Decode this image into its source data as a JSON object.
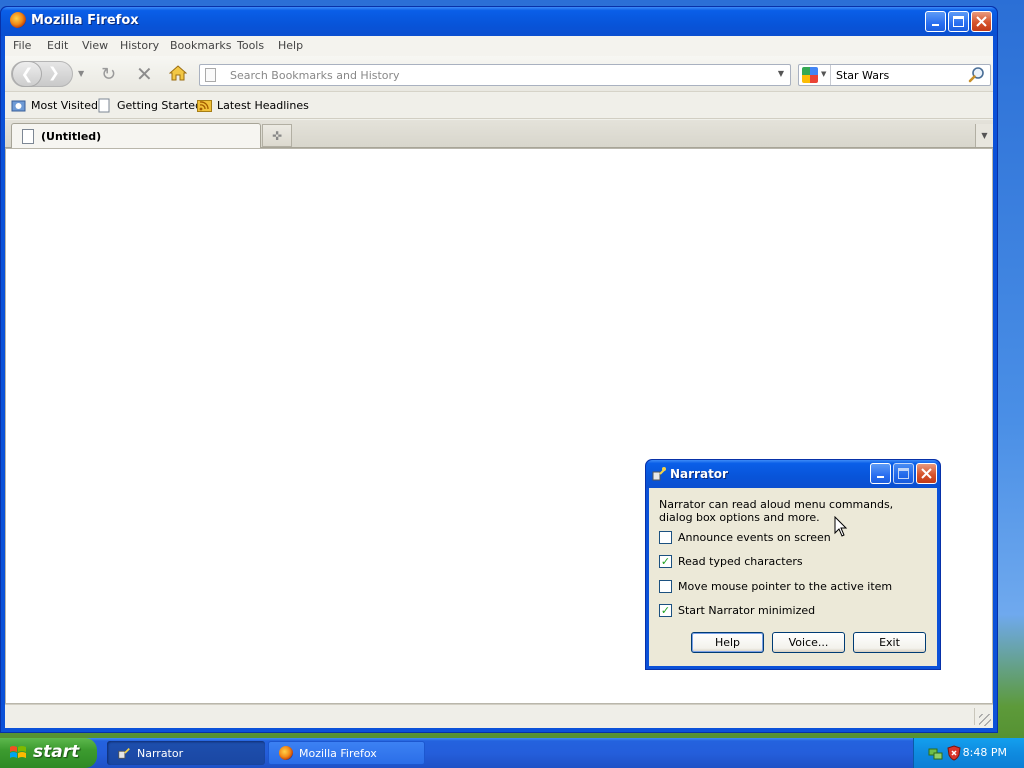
{
  "firefox": {
    "title": "Mozilla Firefox",
    "menu": [
      "File",
      "Edit",
      "View",
      "History",
      "Bookmarks",
      "Tools",
      "Help"
    ],
    "url_placeholder": "Search Bookmarks and History",
    "search_value": "Star Wars",
    "bookmarks": [
      "Most Visited",
      "Getting Started",
      "Latest Headlines"
    ],
    "tab_label": "(Untitled)"
  },
  "narrator": {
    "title": "Narrator",
    "description": "Narrator can read aloud menu commands, dialog box options and more.",
    "options": [
      {
        "label": "Announce events on screen",
        "checked": false
      },
      {
        "label": "Read typed characters",
        "checked": true
      },
      {
        "label": "Move mouse pointer to the active item",
        "checked": false
      },
      {
        "label": "Start Narrator minimized",
        "checked": true
      }
    ],
    "buttons": {
      "help": "Help",
      "voice": "Voice...",
      "exit": "Exit"
    }
  },
  "taskbar": {
    "start_label": "start",
    "tasks": [
      "Narrator",
      "Mozilla Firefox"
    ],
    "clock": "8:48 PM"
  }
}
